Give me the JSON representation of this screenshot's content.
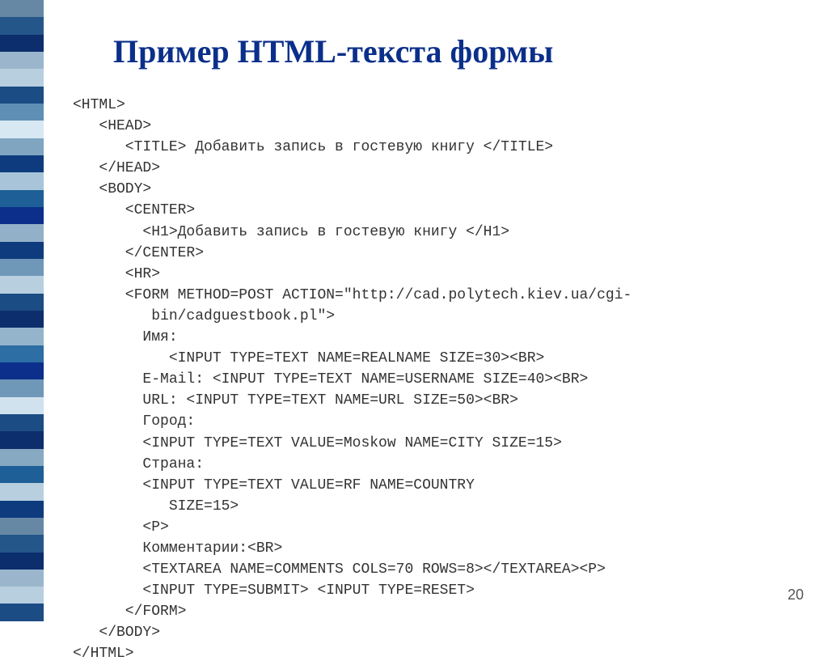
{
  "title": "Пример HTML-текста формы",
  "page_number": "20",
  "code_lines": [
    "<HTML>",
    "   <HEAD>",
    "      <TITLE> Добавить запись в гостевую книгу </TITLE>",
    "   </HEAD>",
    "   <BODY>",
    "      <CENTER>",
    "        <H1>Добавить запись в гостевую книгу </H1>",
    "      </CENTER>",
    "      <HR>",
    "      <FORM METHOD=POST ACTION=\"http://cad.polytech.kiev.ua/cgi-",
    "         bin/cadguestbook.pl\">",
    "        Имя:",
    "           <INPUT TYPE=TEXT NAME=REALNAME SIZE=30><BR>",
    "        E-Mail: <INPUT TYPE=TEXT NAME=USERNAME SIZE=40><BR>",
    "        URL: <INPUT TYPE=TEXT NAME=URL SIZE=50><BR>",
    "        Город:",
    "        <INPUT TYPE=TEXT VALUE=Moskow NAME=CITY SIZE=15>",
    "        Страна:",
    "        <INPUT TYPE=TEXT VALUE=RF NAME=COUNTRY",
    "           SIZE=15>",
    "        <P>",
    "        Комментарии:<BR>",
    "        <TEXTAREA NAME=COMMENTS COLS=70 ROWS=8></TEXTAREA><P>",
    "        <INPUT TYPE=SUBMIT> <INPUT TYPE=RESET>",
    "      </FORM>",
    "   </BODY>",
    "</HTML>"
  ],
  "sidebar_colors": [
    "#6788a5",
    "#24568a",
    "#0d2e6c",
    "#9bb6cc",
    "#b8cfe0",
    "#1b4d84",
    "#5f8fb4",
    "#d8e8f2",
    "#7fa5c1",
    "#0e3b7e",
    "#a8c4d9",
    "#1d5f96",
    "#0b2f8a",
    "#92b0c7",
    "#0e3b7e",
    "#6f97b8",
    "#b8cfe0",
    "#1b4d84",
    "#0d2e6c",
    "#94b4cc",
    "#2d6ea5",
    "#0b2f8a",
    "#6f97b8",
    "#cfe2ee",
    "#1b4d84",
    "#0d2e6c",
    "#88a9c2",
    "#1d5f96",
    "#b8cfe0",
    "#0e3b7e",
    "#6788a5",
    "#24568a",
    "#0d2e6c",
    "#9bb6cc",
    "#b8cfe0",
    "#1b4d84"
  ]
}
